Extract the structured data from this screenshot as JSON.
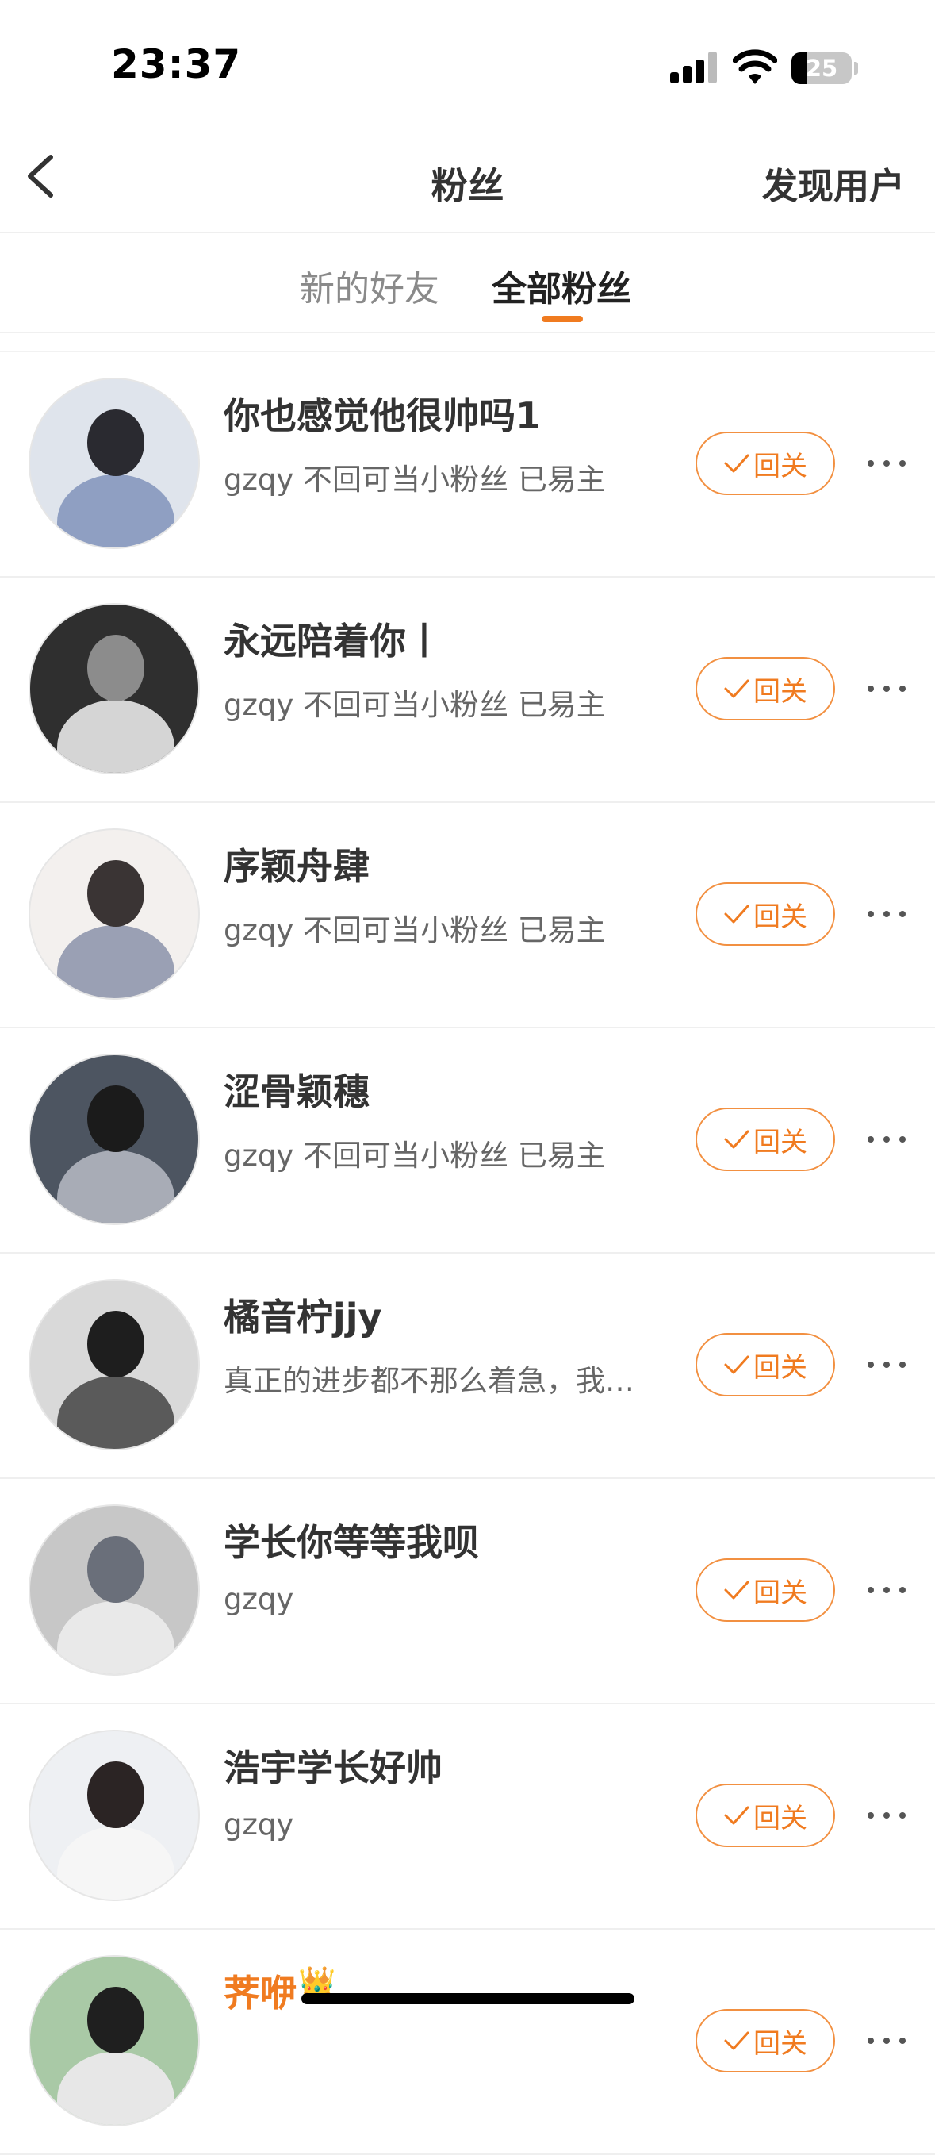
{
  "status_bar": {
    "time": "23:37",
    "battery": "25",
    "battery_level": 0.25,
    "icons": [
      "signal-icon",
      "wifi-icon",
      "battery-icon"
    ]
  },
  "nav": {
    "title": "粉丝",
    "right_action": "发现用户",
    "back_icon": "chevron-left-icon"
  },
  "tabs": [
    {
      "label": "新的好友",
      "active": false
    },
    {
      "label": "全部粉丝",
      "active": true
    }
  ],
  "colors": {
    "accent": "#f07b20",
    "text": "#333333",
    "secondary_text": "#666666"
  },
  "followers": [
    {
      "name": "你也感觉他很帅吗1",
      "bio": "gzqy 不回可当小粉丝 已易主",
      "button": "回关",
      "avatar_colors": [
        "#dfe4ec",
        "#2a2a30",
        "#8f9fc2"
      ]
    },
    {
      "name": "永远陪着你丨",
      "bio": "gzqy 不回可当小粉丝 已易主",
      "button": "回关",
      "avatar_colors": [
        "#2f2f2f",
        "#8c8c8c",
        "#d5d5d5"
      ]
    },
    {
      "name": "序颖舟肆",
      "bio": "gzqy 不回可当小粉丝 已易主",
      "button": "回关",
      "avatar_colors": [
        "#f3f0ee",
        "#3a3434",
        "#9aa0b4"
      ]
    },
    {
      "name": "涩骨颖穗",
      "bio": "gzqy 不回可当小粉丝 已易主",
      "button": "回关",
      "avatar_colors": [
        "#4d5561",
        "#1b1b1b",
        "#a8acb6"
      ]
    },
    {
      "name": "橘音柠jjy",
      "bio": "真正的进步都不那么着急，我…",
      "button": "回关",
      "avatar_colors": [
        "#d9d9d9",
        "#1e1e1e",
        "#5a5a5a"
      ]
    },
    {
      "name": "学长你等等我呗",
      "bio": "gzqy",
      "button": "回关",
      "avatar_colors": [
        "#c7c7c7",
        "#6a6f7a",
        "#e9e9e9"
      ]
    },
    {
      "name": "浩宇学长好帅",
      "bio": "gzqy",
      "button": "回关",
      "avatar_colors": [
        "#eef0f3",
        "#2b2424",
        "#f6f6f6"
      ]
    },
    {
      "name": "荠咿",
      "bio": "",
      "button": "回关",
      "avatar_colors": [
        "#a9c9a6",
        "#1f1f1f",
        "#e7e7e7"
      ]
    }
  ]
}
